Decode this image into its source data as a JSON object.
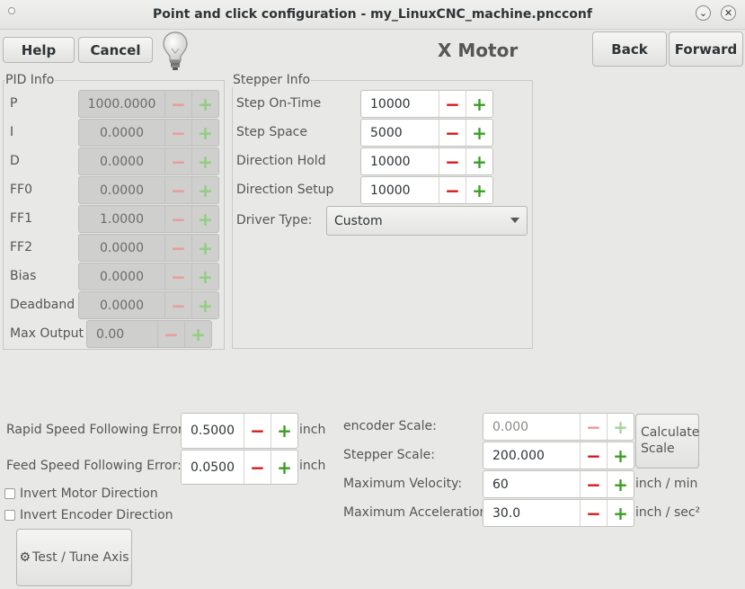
{
  "window": {
    "title": "Point and click configuration - my_LinuxCNC_machine.pncconf"
  },
  "toolbar": {
    "help_label": "Help",
    "cancel_label": "Cancel",
    "page_title": "X Motor",
    "back_label": "Back",
    "forward_label": "Forward"
  },
  "pid": {
    "frame_label": "PID Info",
    "rows": [
      {
        "label": "P",
        "value": "1000.0000"
      },
      {
        "label": "I",
        "value": "0.0000"
      },
      {
        "label": "D",
        "value": "0.0000"
      },
      {
        "label": "FF0",
        "value": "0.0000"
      },
      {
        "label": "FF1",
        "value": "1.0000"
      },
      {
        "label": "FF2",
        "value": "0.0000"
      },
      {
        "label": "Bias",
        "value": "0.0000"
      },
      {
        "label": "Deadband",
        "value": "0.0000"
      },
      {
        "label": "Max Output",
        "value": "0.00"
      }
    ]
  },
  "stepper": {
    "frame_label": "Stepper Info",
    "rows": [
      {
        "label": "Step On-Time",
        "value": "10000"
      },
      {
        "label": "Step Space",
        "value": "5000"
      },
      {
        "label": "Direction Hold",
        "value": "10000"
      },
      {
        "label": "Direction Setup",
        "value": "10000"
      }
    ],
    "driver_label": "Driver Type:",
    "driver_value": "Custom"
  },
  "errors": {
    "rapid_label": "Rapid Speed Following Error:",
    "rapid_value": "0.5000",
    "rapid_unit": "inch",
    "feed_label": "Feed Speed Following Error:",
    "feed_value": "0.0500",
    "feed_unit": "inch"
  },
  "options": {
    "invert_motor": "Invert Motor Direction",
    "invert_encoder": "Invert Encoder Direction"
  },
  "scales": {
    "encoder_label": "encoder Scale:",
    "encoder_value": "0.000",
    "stepper_label": "Stepper Scale:",
    "stepper_value": "200.000",
    "velocity_label": "Maximum Velocity:",
    "velocity_value": "60",
    "velocity_unit": "inch / min",
    "accel_label": "Maximum Acceleration:",
    "accel_value": "30.0",
    "accel_unit": "inch / sec²",
    "calculate_label_1": "Calculate",
    "calculate_label_2": "Scale"
  },
  "test": {
    "label": "Test / Tune Axis"
  },
  "icons": {
    "minus": "−",
    "plus": "+"
  }
}
